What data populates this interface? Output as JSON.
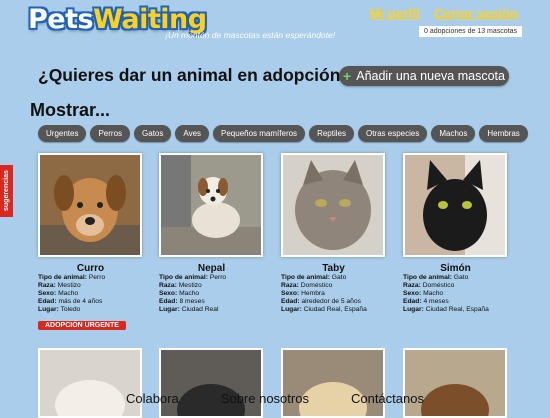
{
  "brand": {
    "logo_pets": "Pets",
    "logo_waiting": "Waiting",
    "tagline": "¡Un montón de mascotas están esperándote!"
  },
  "top_nav": {
    "profile": "Mi perfil",
    "logout": "Cerrar sesión",
    "counter": "0 adopciones de 13 mascotas"
  },
  "sidebar_tab": "sugerencias",
  "hero": {
    "question": "¿Quieres dar un animal en adopción?",
    "add_button": "Añadir una nueva mascota",
    "show_label": "Mostrar..."
  },
  "filters": [
    "Urgentes",
    "Perros",
    "Gatos",
    "Aves",
    "Pequeños mamíferos",
    "Reptiles",
    "Otras especies",
    "Machos",
    "Hembras"
  ],
  "pets": [
    {
      "name": "Curro",
      "tipo": "Perro",
      "raza": "Mestizo",
      "sexo": "Macho",
      "edad": "más de 4 años",
      "lugar": "Toledo",
      "badge": "ADOPCIÓN URGENTE"
    },
    {
      "name": "Nepal",
      "tipo": "Perro",
      "raza": "Mestizo",
      "sexo": "Macho",
      "edad": "8 meses",
      "lugar": "Ciudad Real"
    },
    {
      "name": "Taby",
      "tipo": "Gato",
      "raza": "Doméstico",
      "sexo": "Hembra",
      "edad": "alrededor de 5 años",
      "lugar": "Ciudad Real, España"
    },
    {
      "name": "Simón",
      "tipo": "Gato",
      "raza": "Doméstico",
      "sexo": "Macho",
      "edad": "4 meses",
      "lugar": "Ciudad Real, España"
    }
  ],
  "labels": {
    "tipo": "Tipo de animal:",
    "raza": "Raza:",
    "sexo": "Sexo:",
    "edad": "Edad:",
    "lugar": "Lugar:"
  },
  "footer": {
    "colabora": "Colabora",
    "sobre": "Sobre nosotros",
    "contacto": "Contáctanos"
  },
  "colors": {
    "background": "#a9cdea",
    "accent_yellow": "#ffd21f",
    "urgent_red": "#d8281f",
    "button_gray": "#555555"
  }
}
